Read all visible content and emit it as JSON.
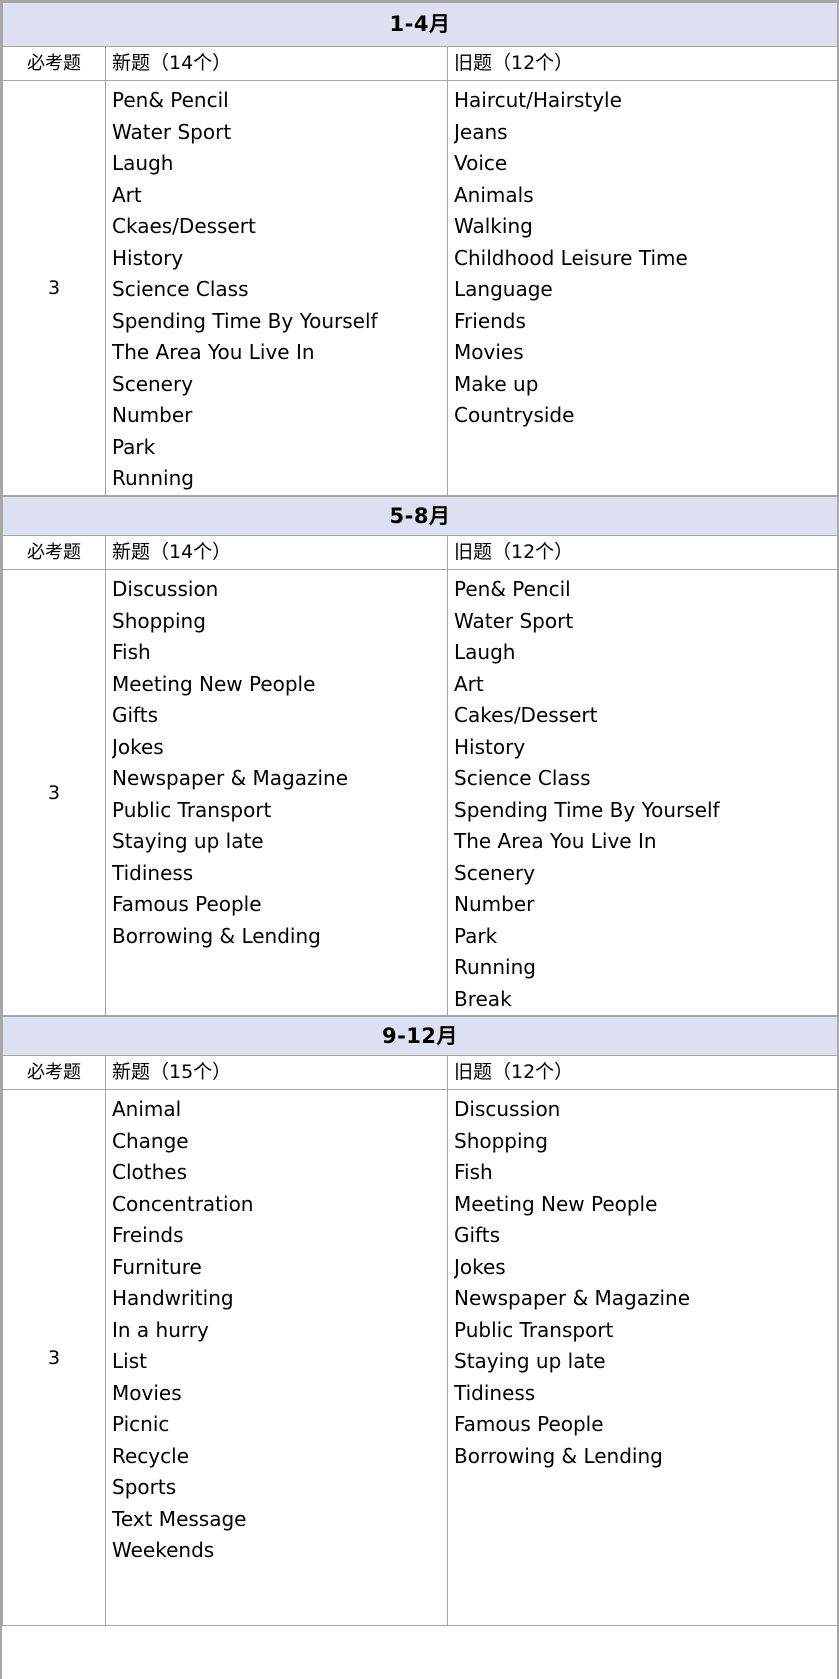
{
  "colors": {
    "banner_background": "#dce0f0",
    "grid_line": "#a6a6a6",
    "text": "#000000",
    "page_background": "#ffffff"
  },
  "columns": {
    "must_label": "必考题",
    "new_label_prefix": "新题",
    "old_label_prefix": "旧题"
  },
  "blocks": [
    {
      "banner": "1-4月",
      "must_header": "必考题",
      "new_header": "新题（14个）",
      "old_header": "旧题（12个）",
      "must_value": "3",
      "new_items": [
        "Pen& Pencil",
        "Water Sport",
        "Laugh",
        "Art",
        "Ckaes/Dessert",
        "History",
        "Science Class",
        "Spending Time By Yourself",
        "The Area You Live In",
        "Scenery",
        "Number",
        "Park",
        "Running"
      ],
      "old_items": [
        "Haircut/Hairstyle",
        "Jeans",
        "Voice",
        "Animals",
        "Walking",
        "Childhood Leisure Time",
        "Language",
        "Friends",
        "Movies",
        "Make up",
        "Countryside"
      ]
    },
    {
      "banner": "5-8月",
      "must_header": "必考题",
      "new_header": "新题（14个）",
      "old_header": "旧题（12个）",
      "must_value": "3",
      "new_items": [
        "Discussion",
        "Shopping",
        "Fish",
        "Meeting New People",
        "Gifts",
        "Jokes",
        "Newspaper & Magazine",
        "Public Transport",
        "Staying up late",
        "Tidiness",
        "Famous People",
        "Borrowing & Lending"
      ],
      "old_items": [
        "Pen& Pencil",
        "Water Sport",
        "Laugh",
        "Art",
        "Cakes/Dessert",
        "History",
        "Science Class",
        "Spending Time By Yourself",
        "The Area You Live In",
        "Scenery",
        "Number",
        "Park",
        "Running",
        "Break"
      ]
    },
    {
      "banner": "9-12月",
      "must_header": "必考题",
      "new_header": "新题（15个）",
      "old_header": "旧题（12个）",
      "must_value": "3",
      "new_items": [
        "Animal",
        "Change",
        "Clothes",
        "Concentration",
        "Freinds",
        "Furniture",
        "Handwriting",
        "In a hurry",
        "List",
        "Movies",
        "Picnic",
        "Recycle",
        "Sports",
        "Text Message",
        "Weekends"
      ],
      "old_items": [
        "Discussion",
        "Shopping",
        "Fish",
        "Meeting New People",
        "Gifts",
        "Jokes",
        "Newspaper & Magazine",
        "Public Transport",
        "Staying up late",
        "Tidiness",
        "Famous People",
        "Borrowing & Lending"
      ]
    }
  ]
}
